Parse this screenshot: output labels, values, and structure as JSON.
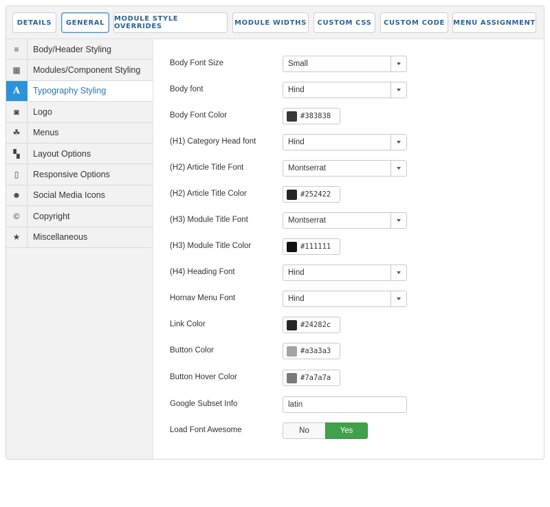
{
  "tabs": [
    {
      "id": "details",
      "label": "DETAILS"
    },
    {
      "id": "general",
      "label": "GENERAL"
    },
    {
      "id": "module-style-overrides",
      "label": "MODULE STYLE OVERRIDES"
    },
    {
      "id": "module-widths",
      "label": "MODULE WIDTHS"
    },
    {
      "id": "custom-css",
      "label": "CUSTOM CSS"
    },
    {
      "id": "custom-code",
      "label": "CUSTOM CODE"
    },
    {
      "id": "menu-assignment",
      "label": "MENU ASSIGNMENT"
    }
  ],
  "active_tab": "GENERAL",
  "sidebar": {
    "items": [
      {
        "label": "Body/Header Styling",
        "icon": "list-icon",
        "glyph": "≡"
      },
      {
        "label": "Modules/Component Styling",
        "icon": "grid-icon",
        "glyph": "▦"
      },
      {
        "label": "Typography Styling",
        "icon": "font-icon",
        "glyph": "A"
      },
      {
        "label": "Logo",
        "icon": "camera-icon",
        "glyph": "◙"
      },
      {
        "label": "Menus",
        "icon": "cubes-icon",
        "glyph": "☘"
      },
      {
        "label": "Layout Options",
        "icon": "layout-icon",
        "glyph": "▚"
      },
      {
        "label": "Responsive Options",
        "icon": "mobile-icon",
        "glyph": "▯"
      },
      {
        "label": "Social Media Icons",
        "icon": "users-icon",
        "glyph": "☻"
      },
      {
        "label": "Copyright",
        "icon": "copyright-icon",
        "glyph": "©"
      },
      {
        "label": "Miscellaneous",
        "icon": "star-icon",
        "glyph": "★"
      }
    ],
    "active_label": "Typography Styling"
  },
  "form": {
    "body_font_size": {
      "label": "Body Font Size",
      "value": "Small"
    },
    "body_font": {
      "label": "Body font",
      "value": "Hind"
    },
    "body_font_color": {
      "label": "Body Font Color",
      "value": "#383838"
    },
    "h1_category_head_font": {
      "label": "(H1) Category Head font",
      "value": "Hind"
    },
    "h2_article_title_font": {
      "label": "(H2) Article Title Font",
      "value": "Montserrat"
    },
    "h2_article_title_color": {
      "label": "(H2) Article Title Color",
      "value": "#252422"
    },
    "h3_module_title_font": {
      "label": "(H3) Module Title Font",
      "value": "Montserrat"
    },
    "h3_module_title_color": {
      "label": "(H3) Module Title Color",
      "value": "#111111"
    },
    "h4_heading_font": {
      "label": "(H4) Heading Font",
      "value": "Hind"
    },
    "hornav_menu_font": {
      "label": "Hornav Menu Font",
      "value": "Hind"
    },
    "link_color": {
      "label": "Link Color",
      "value": "#24282c"
    },
    "button_color": {
      "label": "Button Color",
      "value": "#a3a3a3"
    },
    "button_hover_color": {
      "label": "Button Hover Color",
      "value": "#7a7a7a"
    },
    "google_subset_info": {
      "label": "Google Subset Info",
      "value": "latin"
    },
    "load_font_awesome": {
      "label": "Load Font Awesome",
      "no_label": "No",
      "yes_label": "Yes",
      "selected": "Yes"
    }
  },
  "colors": {
    "accent": "#2d93d8",
    "tab_text": "#2a6496",
    "toggle_yes": "#3fa14a"
  }
}
